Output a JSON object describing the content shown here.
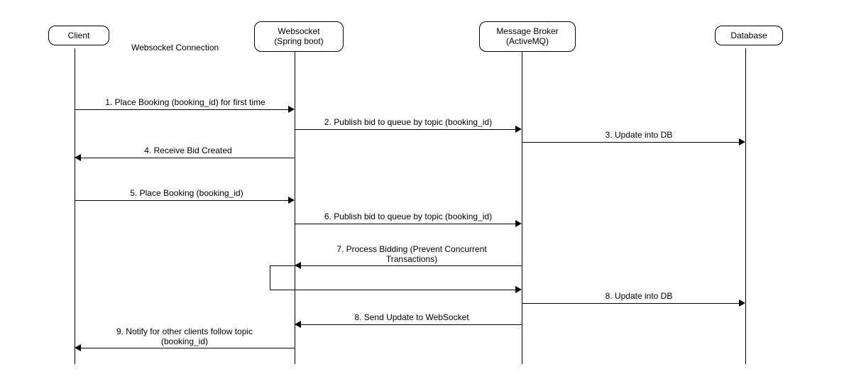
{
  "actors": {
    "client": "Client",
    "websocket": "Websocket\n(Spring boot)",
    "broker": "Message Broker\n(ActiveMQ)",
    "database": "Database"
  },
  "connection_label": "Websocket Connection",
  "messages": {
    "m1": "1. Place Booking (booking_id) for first time",
    "m2": "2. Publish bid to queue by topic (booking_id)",
    "m3": "3. Update into DB",
    "m4": "4. Receive Bid Created",
    "m5": "5. Place Booking (booking_id)",
    "m6": "6. Publish bid to queue by topic (booking_id)",
    "m7": "7. Process Bidding (Prevent Concurrent\nTransactions)",
    "m8a": "8. Update into DB",
    "m8b": "8. Send Update to WebSocket",
    "m9": "9. Notify for other clients follow topic\n(booking_id)"
  }
}
